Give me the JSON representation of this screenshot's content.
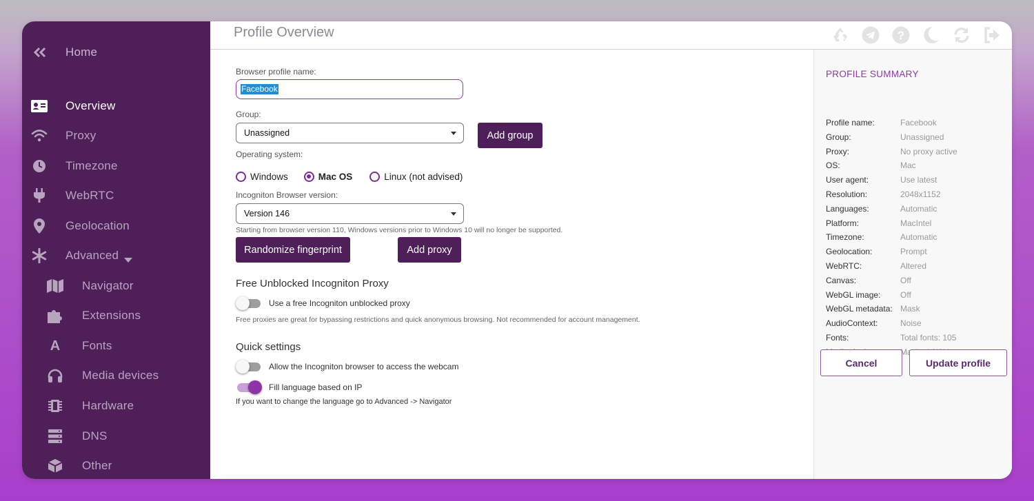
{
  "sidebar": {
    "collapse_icon": "double-chevron-left-icon",
    "home_label": "Home",
    "items": [
      {
        "label": "Overview",
        "icon": "id-card-icon"
      },
      {
        "label": "Proxy",
        "icon": "wifi-icon"
      },
      {
        "label": "Timezone",
        "icon": "clock-icon"
      },
      {
        "label": "WebRTC",
        "icon": "plug-icon"
      },
      {
        "label": "Geolocation",
        "icon": "map-pin-icon"
      },
      {
        "label": "Advanced",
        "icon": "asterisk-icon"
      },
      {
        "label": "Navigator",
        "icon": "map-icon"
      },
      {
        "label": "Extensions",
        "icon": "puzzle-icon"
      },
      {
        "label": "Fonts",
        "icon": "font-icon"
      },
      {
        "label": "Media devices",
        "icon": "headphones-icon"
      },
      {
        "label": "Hardware",
        "icon": "chip-icon"
      },
      {
        "label": "DNS",
        "icon": "server-icon"
      },
      {
        "label": "Other",
        "icon": "cube-icon"
      }
    ],
    "active": "Overview"
  },
  "header": {
    "title": "Profile Overview",
    "icons": [
      "recycle-icon",
      "telegram-icon",
      "help-icon",
      "moon-icon",
      "sync-icon",
      "logout-icon"
    ]
  },
  "form": {
    "profile_name_label": "Browser profile name:",
    "profile_name_value": "Facebook",
    "group_label": "Group:",
    "group_value": "Unassigned",
    "add_group_label": "Add group",
    "os_label": "Operating system:",
    "os_options": [
      "Windows",
      "Mac OS",
      "Linux (not advised)"
    ],
    "os_selected": "Mac OS",
    "browser_version_label": "Incogniton Browser version:",
    "browser_version_value": "Version 146",
    "version_hint": "Starting from browser version 110, Windows versions prior to Windows 10 will no longer be supported.",
    "randomize_label": "Randomize fingerprint",
    "add_proxy_label": "Add proxy"
  },
  "free_proxy": {
    "title": "Free Unblocked Incogniton Proxy",
    "toggle_label": "Use a free Incogniton unblocked proxy",
    "enabled": false,
    "hint": "Free proxies are great for bypassing restrictions and quick anonymous browsing. Not recommended for account management."
  },
  "quick_settings": {
    "title": "Quick settings",
    "webcam_label": "Allow the Incogniton browser to access the webcam",
    "webcam_enabled": false,
    "language_label": "Fill language based on IP",
    "language_enabled": true,
    "hint": "If you want to change the language go to Advanced -> Navigator"
  },
  "summary": {
    "title": "PROFILE SUMMARY",
    "rows": [
      {
        "key": "Profile name:",
        "value": "Facebook"
      },
      {
        "key": "Group:",
        "value": "Unassigned"
      },
      {
        "key": "Proxy:",
        "value": "No proxy active"
      },
      {
        "key": "OS:",
        "value": "Mac"
      },
      {
        "key": "User agent:",
        "value": "Use latest"
      },
      {
        "key": "Resolution:",
        "value": "2048x1152"
      },
      {
        "key": "Languages:",
        "value": "Automatic"
      },
      {
        "key": "Platform:",
        "value": "MacIntel"
      },
      {
        "key": "Timezone:",
        "value": "Automatic"
      },
      {
        "key": "Geolocation:",
        "value": "Prompt"
      },
      {
        "key": "WebRTC:",
        "value": "Altered"
      },
      {
        "key": "Canvas:",
        "value": "Off"
      },
      {
        "key": "WebGL image:",
        "value": "Off"
      },
      {
        "key": "WebGL metadata:",
        "value": "Mask"
      },
      {
        "key": "AudioContext:",
        "value": "Noise"
      },
      {
        "key": "Fonts:",
        "value": "Total fonts: 105"
      },
      {
        "key": "Media devices:",
        "value": "Masked 2|3|4"
      }
    ],
    "cancel_label": "Cancel",
    "update_label": "Update profile"
  },
  "colors": {
    "sidebar_bg": "#4f1f5a",
    "accent": "#8b3aa3",
    "button_dark": "#4f1f5a"
  }
}
